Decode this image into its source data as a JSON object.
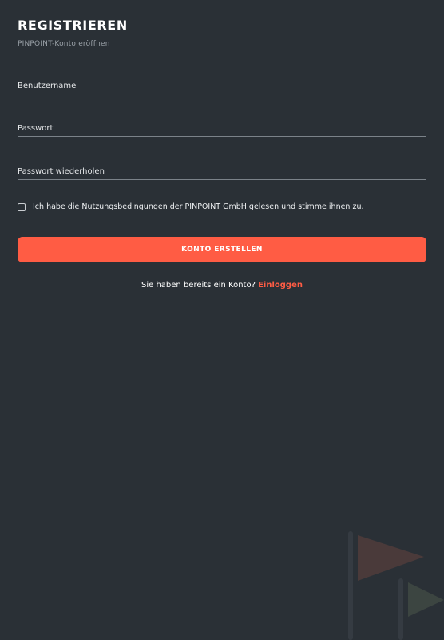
{
  "header": {
    "title": "REGISTRIEREN",
    "subtitle": "PINPOINT-Konto eröffnen"
  },
  "form": {
    "username_placeholder": "Benutzername",
    "password_placeholder": "Passwort",
    "password_repeat_placeholder": "Passwort wiederholen",
    "terms_label": "Ich habe die Nutzungsbedingungen der PINPOINT GmbH gelesen und stimme ihnen zu.",
    "terms_checked": false,
    "submit_label": "KONTO ERSTELLEN"
  },
  "footer": {
    "login_prompt": "Sie haben bereits ein Konto?",
    "login_link": "Einloggen"
  },
  "colors": {
    "background": "#2a3036",
    "accent": "#ff5c44",
    "underline": "#7b8289"
  },
  "decoration": {
    "icon": "flags-icon"
  }
}
